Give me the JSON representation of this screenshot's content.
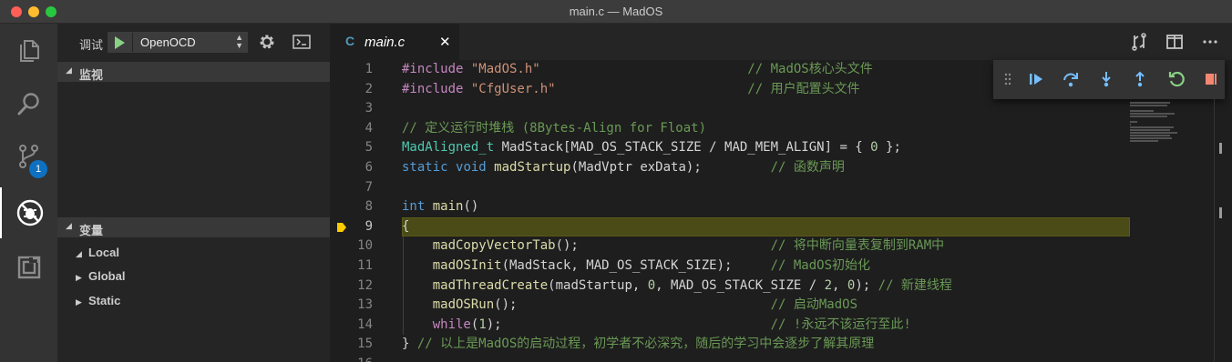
{
  "window": {
    "title": "main.c — MadOS"
  },
  "activity_bar": {
    "items": [
      "explorer-icon",
      "search-icon",
      "source-control-icon",
      "debug-icon",
      "extensions-icon"
    ],
    "scm_badge": "1"
  },
  "sidebar": {
    "debug_label": "调试",
    "config_name": "OpenOCD",
    "watch_header": "监视",
    "variables_header": "变量",
    "variables": [
      {
        "label": "Local",
        "expanded": true
      },
      {
        "label": "Global",
        "expanded": false
      },
      {
        "label": "Static",
        "expanded": false
      }
    ]
  },
  "tabs": [
    {
      "icon": "C",
      "label": "main.c"
    }
  ],
  "editor": {
    "current_line": 9,
    "lines": [
      {
        "n": "1",
        "tokens": [
          [
            "p",
            "#include "
          ],
          [
            "s",
            "\"MadOS.h\""
          ],
          [
            "",
            "                           "
          ],
          [
            "c",
            "// MadOS核心头文件"
          ]
        ]
      },
      {
        "n": "2",
        "tokens": [
          [
            "p",
            "#include "
          ],
          [
            "s",
            "\"CfgUser.h\""
          ],
          [
            "",
            "                         "
          ],
          [
            "c",
            "// 用户配置头文件"
          ]
        ]
      },
      {
        "n": "3",
        "tokens": []
      },
      {
        "n": "4",
        "tokens": [
          [
            "c",
            "// 定义运行时堆栈 (8Bytes-Align for Float)"
          ]
        ]
      },
      {
        "n": "5",
        "tokens": [
          [
            "t",
            "MadAligned_t"
          ],
          [
            "",
            " MadStack[MAD_OS_STACK_SIZE / MAD_MEM_ALIGN] = { "
          ],
          [
            "n",
            "0"
          ],
          [
            "",
            " };"
          ]
        ]
      },
      {
        "n": "6",
        "tokens": [
          [
            "k",
            "static"
          ],
          [
            "",
            " "
          ],
          [
            "k",
            "void"
          ],
          [
            "",
            " "
          ],
          [
            "f",
            "madStartup"
          ],
          [
            "",
            "(MadVptr exData);         "
          ],
          [
            "c",
            "// 函数声明"
          ]
        ]
      },
      {
        "n": "7",
        "tokens": []
      },
      {
        "n": "8",
        "tokens": [
          [
            "k",
            "int"
          ],
          [
            "",
            " "
          ],
          [
            "f",
            "main"
          ],
          [
            "",
            "()"
          ]
        ]
      },
      {
        "n": "9",
        "tokens": [
          [
            "",
            "{"
          ]
        ]
      },
      {
        "n": "10",
        "tokens": [
          [
            "",
            "    "
          ],
          [
            "f",
            "madCopyVectorTab"
          ],
          [
            "",
            "();                         "
          ],
          [
            "c",
            "// 将中断向量表复制到RAM中"
          ]
        ]
      },
      {
        "n": "11",
        "tokens": [
          [
            "",
            "    "
          ],
          [
            "f",
            "madOSInit"
          ],
          [
            "",
            "(MadStack, MAD_OS_STACK_SIZE);     "
          ],
          [
            "c",
            "// MadOS初始化"
          ]
        ]
      },
      {
        "n": "12",
        "tokens": [
          [
            "",
            "    "
          ],
          [
            "f",
            "madThreadCreate"
          ],
          [
            "",
            "(madStartup, "
          ],
          [
            "n",
            "0"
          ],
          [
            "",
            ", MAD_OS_STACK_SIZE / "
          ],
          [
            "n",
            "2"
          ],
          [
            "",
            ", "
          ],
          [
            "n",
            "0"
          ],
          [
            "",
            "); "
          ],
          [
            "c",
            "// 新建线程"
          ]
        ]
      },
      {
        "n": "13",
        "tokens": [
          [
            "",
            "    "
          ],
          [
            "f",
            "madOSRun"
          ],
          [
            "",
            "();                                 "
          ],
          [
            "c",
            "// 启动MadOS"
          ]
        ]
      },
      {
        "n": "14",
        "tokens": [
          [
            "",
            "    "
          ],
          [
            "p",
            "while"
          ],
          [
            "",
            "("
          ],
          [
            "n",
            "1"
          ],
          [
            "",
            ");                                   "
          ],
          [
            "c",
            "// !永远不该运行至此!"
          ]
        ]
      },
      {
        "n": "15",
        "tokens": [
          [
            "",
            "} "
          ],
          [
            "c",
            "// 以上是MadOS的启动过程，初学者不必深究，随后的学习中会逐步了解其原理"
          ]
        ]
      },
      {
        "n": "16",
        "tokens": []
      }
    ]
  },
  "debug_toolbar": [
    "continue-icon",
    "step-over-icon",
    "step-into-icon",
    "step-out-icon",
    "restart-icon",
    "stop-icon"
  ],
  "colors": {
    "continue": "#75beff",
    "restart": "#89d185",
    "stop": "#f48771",
    "current_line": "#4b4b18",
    "breakpoint_arrow": "#ffcc00"
  }
}
